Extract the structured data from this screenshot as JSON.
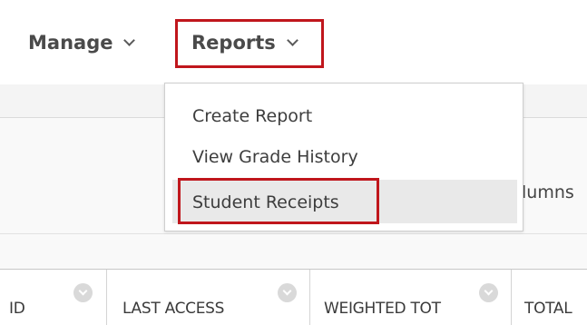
{
  "nav": {
    "manage_label": "Manage",
    "reports_label": "Reports"
  },
  "reports_menu": {
    "items": [
      {
        "label": "Create Report"
      },
      {
        "label": "View Grade History"
      },
      {
        "label": "Student Receipts",
        "highlighted": true
      }
    ]
  },
  "toolbar": {
    "columns_fragment": "lumns"
  },
  "table": {
    "columns": [
      {
        "label": "ID"
      },
      {
        "label": "LAST ACCESS"
      },
      {
        "label": "WEIGHTED TOT"
      },
      {
        "label": "TOTAL"
      }
    ]
  },
  "colors": {
    "highlight_border": "#c0161c",
    "menu_hover": "#e9e9e9"
  }
}
